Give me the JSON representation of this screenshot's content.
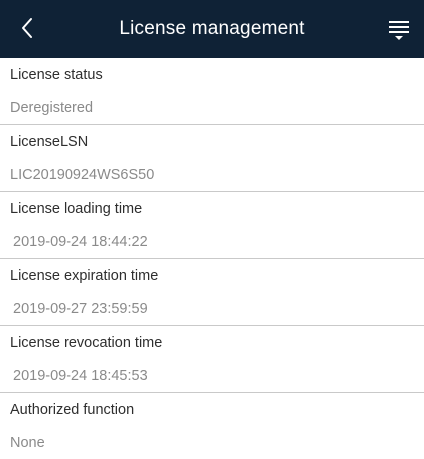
{
  "header": {
    "title": "License management",
    "back_icon": "chevron-left-icon",
    "menu_icon": "menu-icon"
  },
  "fields": [
    {
      "label": "License status",
      "value": "Deregistered"
    },
    {
      "label": "LicenseLSN",
      "value": "LIC20190924WS6S50"
    },
    {
      "label": "License loading time",
      "value": "2019-09-24 18:44:22"
    },
    {
      "label": "License expiration time",
      "value": "2019-09-27 23:59:59"
    },
    {
      "label": "License revocation time",
      "value": "2019-09-24 18:45:53"
    },
    {
      "label": "Authorized function",
      "value": "None"
    }
  ],
  "colors": {
    "header_bg": "#0f2236",
    "header_text": "#ffffff",
    "label_text": "#2e2e2e",
    "value_text": "#8a8a8a",
    "divider": "#c9c9c9"
  }
}
